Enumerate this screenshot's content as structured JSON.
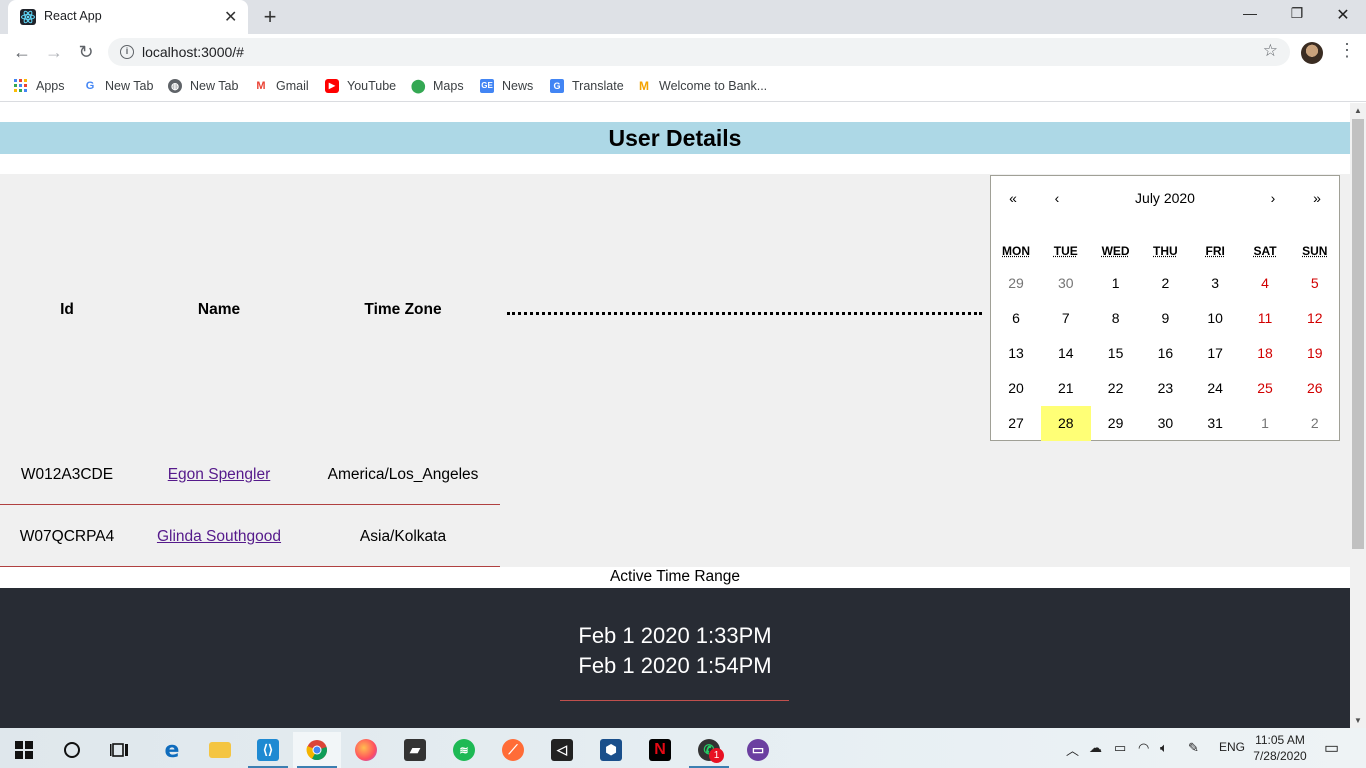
{
  "browser": {
    "tab_title": "React App",
    "url": "localhost:3000/#",
    "tab_close": "✕",
    "new_tab": "+",
    "window_controls": {
      "minimize": "—",
      "restore": "❐",
      "close": "✕"
    },
    "nav": {
      "back": "←",
      "forward": "→",
      "reload": "↻"
    },
    "bookmarks": [
      {
        "label": "Apps",
        "icon": "apps-grid-icon"
      },
      {
        "label": "New Tab",
        "icon": "google-icon"
      },
      {
        "label": "New Tab",
        "icon": "globe-icon"
      },
      {
        "label": "Gmail",
        "icon": "gmail-icon"
      },
      {
        "label": "YouTube",
        "icon": "youtube-icon"
      },
      {
        "label": "Maps",
        "icon": "maps-pin-icon"
      },
      {
        "label": "News",
        "icon": "news-icon"
      },
      {
        "label": "Translate",
        "icon": "translate-icon"
      },
      {
        "label": "Welcome to Bank...",
        "icon": "bank-icon"
      }
    ]
  },
  "page": {
    "title": "User Details",
    "table": {
      "headers": [
        "Id",
        "Name",
        "Time Zone"
      ],
      "rows": [
        {
          "id": "W012A3CDE",
          "name": "Egon Spengler",
          "tz": "America/Los_Angeles"
        },
        {
          "id": "W07QCRPA4",
          "name": "Glinda Southgood",
          "tz": "Asia/Kolkata"
        }
      ]
    },
    "calendar": {
      "label": "July 2020",
      "prev2": "«",
      "prev": "‹",
      "next": "›",
      "next2": "»",
      "weekdays": [
        "MON",
        "TUE",
        "WED",
        "THU",
        "FRI",
        "SAT",
        "SUN"
      ],
      "weeks": [
        [
          "29",
          "30",
          "1",
          "2",
          "3",
          "4",
          "5"
        ],
        [
          "6",
          "7",
          "8",
          "9",
          "10",
          "11",
          "12"
        ],
        [
          "13",
          "14",
          "15",
          "16",
          "17",
          "18",
          "19"
        ],
        [
          "20",
          "21",
          "22",
          "23",
          "24",
          "25",
          "26"
        ],
        [
          "27",
          "28",
          "29",
          "30",
          "31",
          "1",
          "2"
        ]
      ],
      "selected_day": "28"
    },
    "active_range_label": "Active Time Range",
    "range_start": "Feb 1 2020 1:33PM",
    "range_end": "Feb 1 2020 1:54PM"
  },
  "taskbar": {
    "clock_time": "11:05 AM",
    "clock_date": "7/28/2020",
    "language": "ENG",
    "whatsapp_badge": "1",
    "apps": [
      "windows-start-icon",
      "search-circle-icon",
      "task-view-icon",
      "edge-icon",
      "file-explorer-icon",
      "vscode-icon",
      "chrome-icon",
      "firefox-icon",
      "sticky-notes-icon",
      "spotify-icon",
      "postman-icon",
      "unity-icon",
      "virtualbox-icon",
      "netflix-icon",
      "whatsapp-icon",
      "app-purple-icon"
    ]
  },
  "colors": {
    "header_bar": "#add8e6",
    "content_grey": "#f0f0f0",
    "dark_panel": "#282c34",
    "calendar_highlight": "#ffff76",
    "weekend_red": "#d10000",
    "row_divider": "#b04040"
  }
}
